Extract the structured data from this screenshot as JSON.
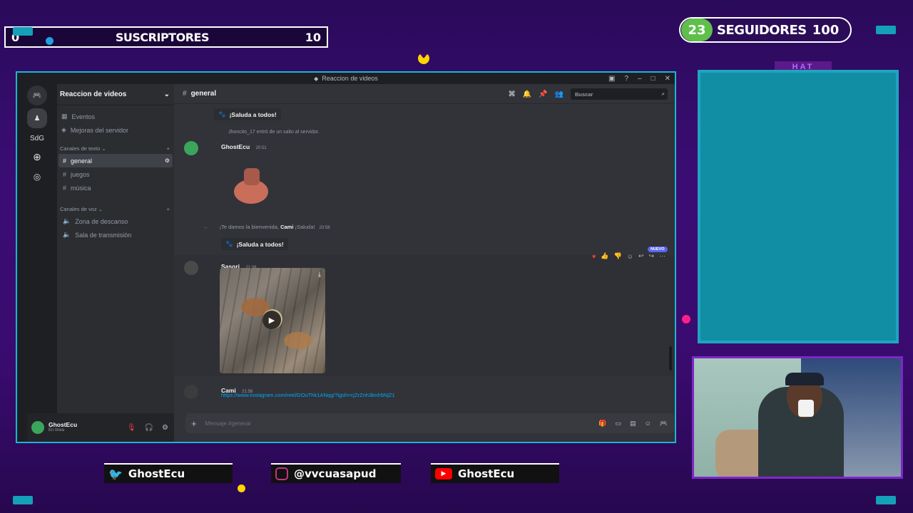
{
  "overlay": {
    "subs": {
      "left": "0",
      "title": "SUSCRIPTORES",
      "right": "10"
    },
    "followers": {
      "current": "23",
      "title": "SEGUIDORES",
      "goal": "100"
    },
    "chat_header": "HAT",
    "socials": [
      {
        "icon": "twitter-icon",
        "handle": "GhostEcu",
        "color": "#1da1f2"
      },
      {
        "icon": "instagram-icon",
        "handle": "@vvcuasapud",
        "color": "#c13584"
      },
      {
        "icon": "youtube-icon",
        "handle": "GhostEcu",
        "color": "#ff0000"
      }
    ]
  },
  "discord": {
    "window_title": "Reaccion de videos",
    "server_label": "SdG",
    "server_name": "Reaccion de videos",
    "nav": {
      "events": "Eventos",
      "boosts": "Mejoras del servidor"
    },
    "text_category": "Canales de texto",
    "text_channels": [
      "general",
      "juegos",
      "música"
    ],
    "voice_category": "Canales de voz",
    "voice_channels": [
      "Zona de descanso",
      "Sala de transmisión"
    ],
    "user": {
      "name": "GhostEcu",
      "status": "En línea"
    },
    "channel": {
      "name": "general",
      "search_placeholder": "Buscar"
    },
    "messages": {
      "sticker_label": "¡Saluda a todos!",
      "join1": "Jhoncito_17 entró de un salto al servidor.",
      "ghost_name": "GhostEcu",
      "ghost_time": "20:51",
      "welcome_prefix": "¡Te damos la bienvenida,",
      "welcome_name": "Cami",
      "welcome_suffix": "¡Saluda!",
      "welcome_time": "20:58",
      "sasori_name": "Sasori",
      "sasori_time": "21:38",
      "new_badge": "NUEVO",
      "cami_name": "Cami",
      "cami_time": "21:56",
      "cami_link": "https://www.instagram.com/reel/DOuThk1ANqg/?igsh=cjZrZnh3bnh5NjZ1"
    },
    "composer_placeholder": "Mensaje #general"
  }
}
